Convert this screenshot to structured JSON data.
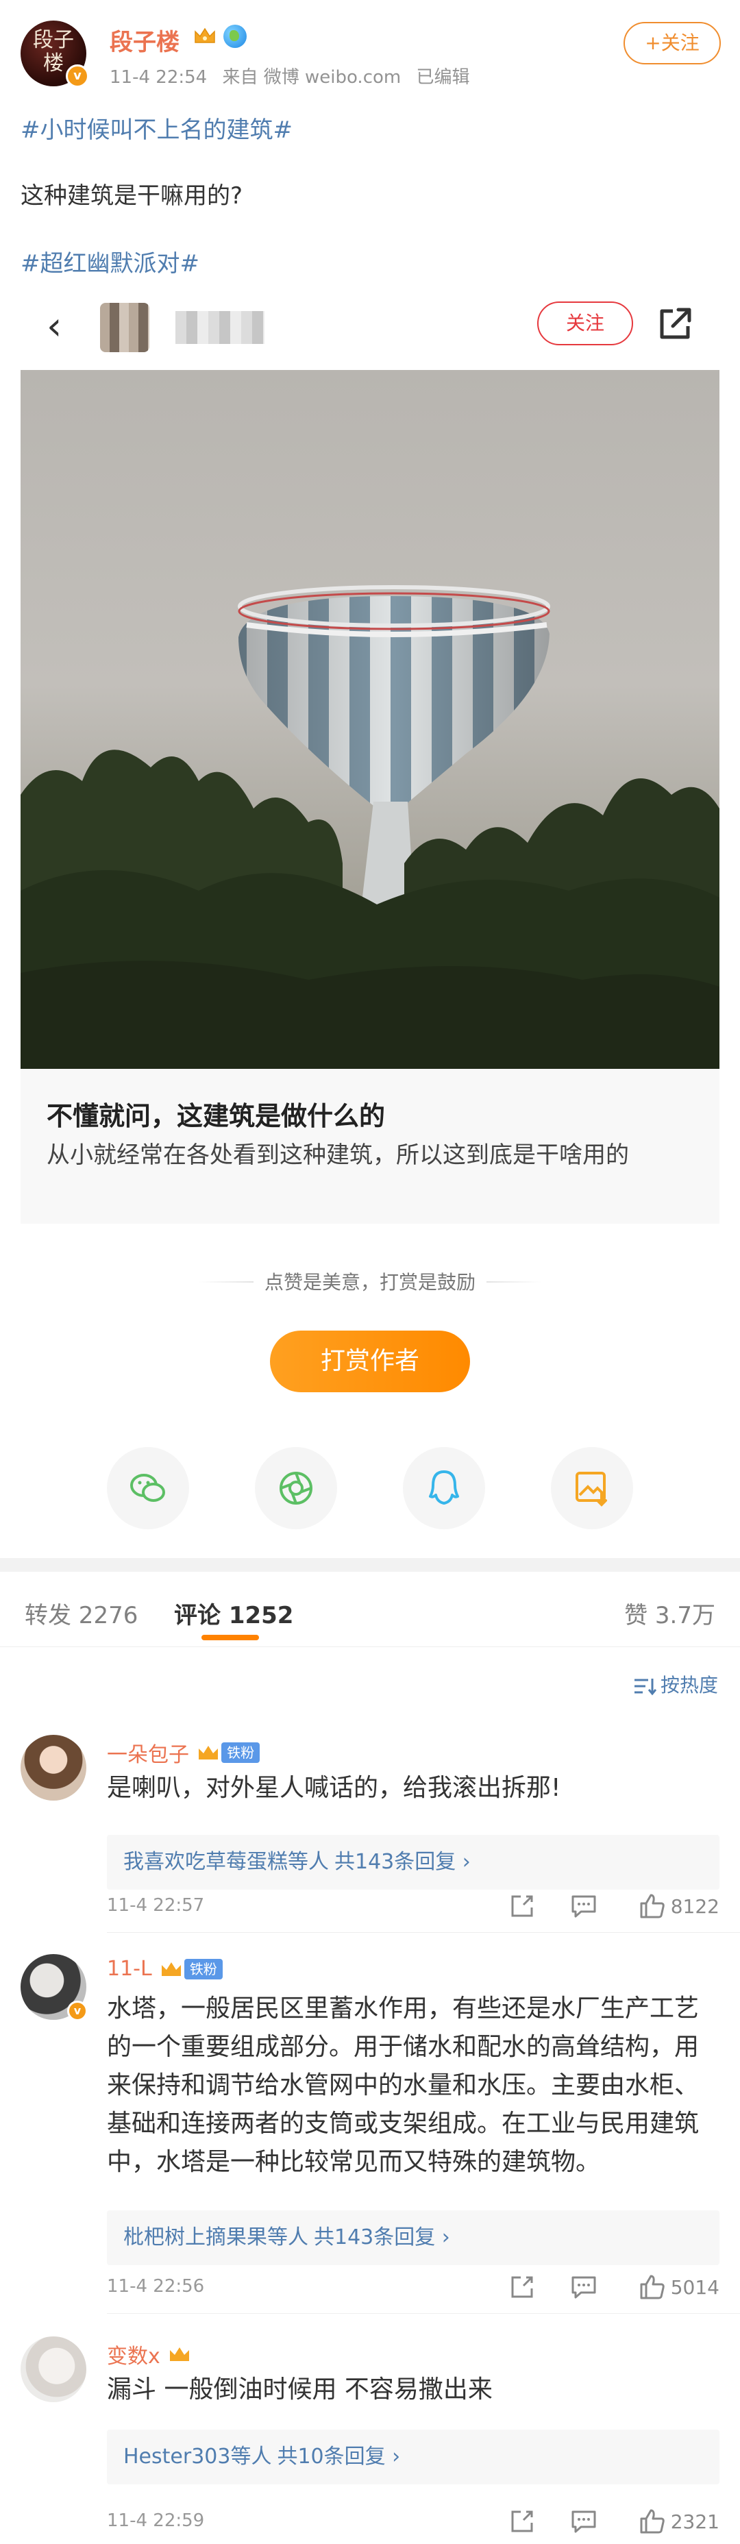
{
  "post": {
    "author": "段子楼",
    "avatar_text": "段子楼",
    "avatar_badge": "v",
    "time": "11-4 22:54",
    "source": "来自 微博 weibo.com",
    "edited": "已编辑",
    "follow_label": "+关注",
    "topic_1": "#小时候叫不上名的建筑#",
    "text": "这种建筑是干嘛用的?",
    "topic_2": "#超红幽默派对#"
  },
  "embed": {
    "back_icon": "‹",
    "follow_label": "关注",
    "caption_title": "不懂就问，这建筑是做什么的",
    "caption_text": "从小就经常在各处看到这种建筑，所以这到底是干啥用的"
  },
  "reward": {
    "tip": "点赞是美意，打赏是鼓励",
    "button_label": "打赏作者"
  },
  "share_icons": [
    "wechat-icon",
    "moments-icon",
    "qq-icon",
    "save-image-icon"
  ],
  "tabs": {
    "repost": "转发 2276",
    "comment": "评论 1252",
    "like": "赞 3.7万"
  },
  "sort_label": "按热度",
  "colors": {
    "brand_orange": "#ff8200",
    "name_orange": "#eb7350",
    "link_blue": "#507daf",
    "fan_badge_blue": "#5a98e8"
  },
  "comments": [
    {
      "name": "一朵包子",
      "badge": "铁粉",
      "text": "是喇叭，对外星人喊话的，给我滚出拆那!",
      "reply_who": "我喜欢吃草莓蛋糕等人",
      "reply_count": "共143条回复 ›",
      "time": "11-4 22:57",
      "likes": "8122"
    },
    {
      "name": "11-L",
      "badge": "铁粉",
      "text": "水塔，一般居民区里蓄水作用，有些还是水厂生产工艺的一个重要组成部分。用于储水和配水的高耸结构，用来保持和调节给水管网中的水量和水压。主要由水柜、基础和连接两者的支筒或支架组成。在工业与民用建筑中，水塔是一种比较常见而又特殊的建筑物。",
      "reply_who": "枇杷树上摘果果等人",
      "reply_count": "共143条回复 ›",
      "time": "11-4 22:56",
      "likes": "5014"
    },
    {
      "name": "变数x",
      "badge": "",
      "text": "漏斗  一般倒油时候用  不容易撒出来",
      "reply_who": "Hester303等人",
      "reply_count": "共10条回复 ›",
      "time": "11-4 22:59",
      "likes": "2321"
    }
  ]
}
